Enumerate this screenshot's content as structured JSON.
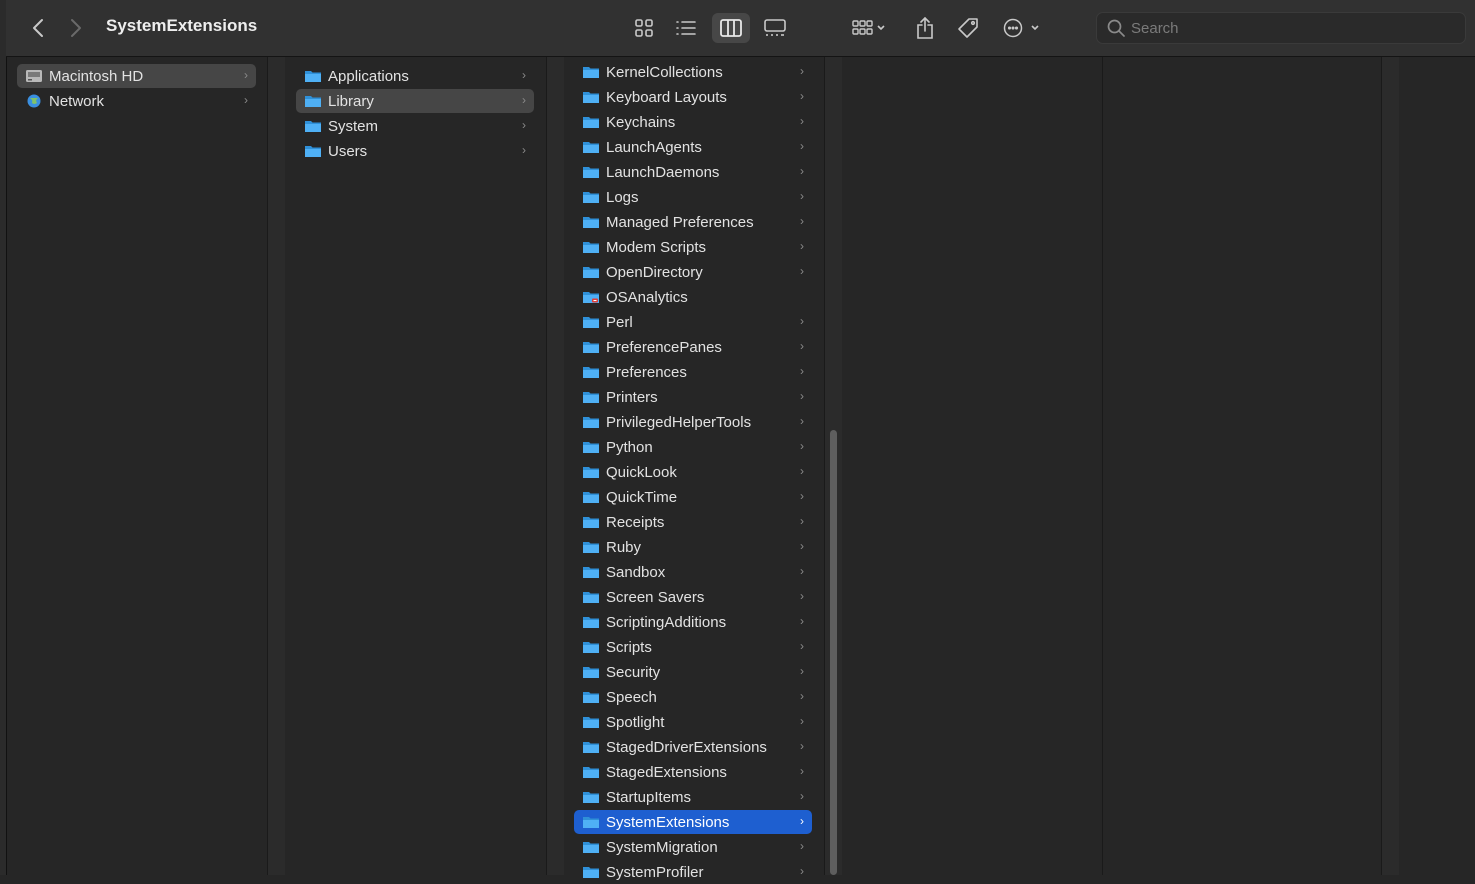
{
  "window": {
    "title": "SystemExtensions"
  },
  "toolbar": {
    "search_placeholder": "Search",
    "icons": [
      "back-icon",
      "forward-icon",
      "icon-view-icon",
      "list-view-icon",
      "column-view-icon",
      "gallery-view-icon",
      "group-icon",
      "share-icon",
      "tag-icon",
      "more-icon",
      "search-icon"
    ]
  },
  "columns": {
    "devices": [
      {
        "label": "Macintosh HD",
        "icon": "hard-drive-icon"
      },
      {
        "label": "Network",
        "icon": "network-globe-icon"
      }
    ],
    "root": [
      {
        "label": "Applications"
      },
      {
        "label": "Library"
      },
      {
        "label": "System"
      },
      {
        "label": "Users"
      }
    ],
    "library": [
      {
        "label": "KernelCollections"
      },
      {
        "label": "Keyboard Layouts"
      },
      {
        "label": "Keychains"
      },
      {
        "label": "LaunchAgents"
      },
      {
        "label": "LaunchDaemons"
      },
      {
        "label": "Logs"
      },
      {
        "label": "Managed Preferences"
      },
      {
        "label": "Modem Scripts"
      },
      {
        "label": "OpenDirectory"
      },
      {
        "label": "OSAnalytics"
      },
      {
        "label": "Perl"
      },
      {
        "label": "PreferencePanes"
      },
      {
        "label": "Preferences"
      },
      {
        "label": "Printers"
      },
      {
        "label": "PrivilegedHelperTools"
      },
      {
        "label": "Python"
      },
      {
        "label": "QuickLook"
      },
      {
        "label": "QuickTime"
      },
      {
        "label": "Receipts"
      },
      {
        "label": "Ruby"
      },
      {
        "label": "Sandbox"
      },
      {
        "label": "Screen Savers"
      },
      {
        "label": "ScriptingAdditions"
      },
      {
        "label": "Scripts"
      },
      {
        "label": "Security"
      },
      {
        "label": "Speech"
      },
      {
        "label": "Spotlight"
      },
      {
        "label": "StagedDriverExtensions"
      },
      {
        "label": "StagedExtensions"
      },
      {
        "label": "StartupItems"
      },
      {
        "label": "SystemExtensions"
      },
      {
        "label": "SystemMigration"
      },
      {
        "label": "SystemProfiler"
      }
    ]
  },
  "colors": {
    "selection_blue": "#1e5fd0",
    "selection_gray": "#464646",
    "folder_blue": "#3aa6f0"
  }
}
